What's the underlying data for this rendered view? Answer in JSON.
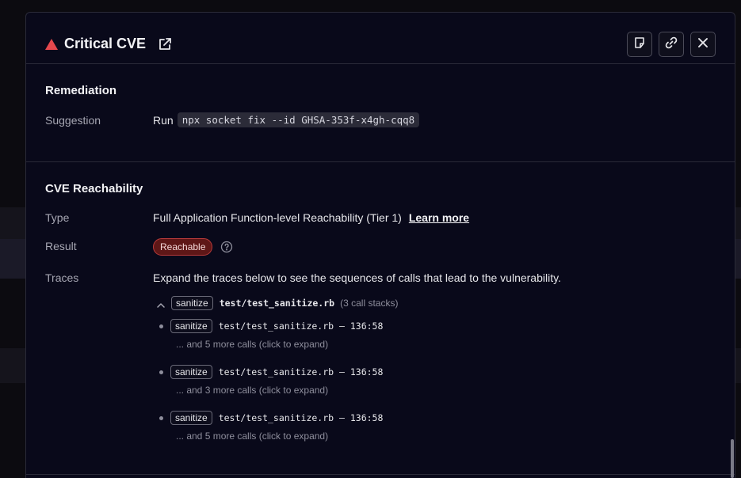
{
  "modal": {
    "title": "Critical CVE",
    "icons": {
      "severity": "warning-triangle-icon",
      "external": "external-link-icon",
      "note": "sticky-note-icon",
      "link": "link-icon",
      "close": "close-icon"
    }
  },
  "remediation": {
    "title": "Remediation",
    "suggestion_label": "Suggestion",
    "run_text": "Run",
    "command": "npx socket fix --id GHSA-353f-x4gh-cqq8"
  },
  "reachability": {
    "title": "CVE Reachability",
    "type_label": "Type",
    "type_value": "Full Application Function-level Reachability (Tier 1)",
    "learn_more": "Learn more",
    "result_label": "Result",
    "result_badge": "Reachable",
    "traces_label": "Traces",
    "traces_intro": "Expand the traces below to see the sequences of calls that lead to the vulnerability.",
    "group": {
      "fn": "sanitize",
      "file": "test/test_sanitize.rb",
      "count": "(3 call stacks)"
    },
    "traces": [
      {
        "fn": "sanitize",
        "loc": "test/test_sanitize.rb – 136:58",
        "more": "... and 5 more calls (click to expand)"
      },
      {
        "fn": "sanitize",
        "loc": "test/test_sanitize.rb – 136:58",
        "more": "... and 3 more calls (click to expand)"
      },
      {
        "fn": "sanitize",
        "loc": "test/test_sanitize.rb – 136:58",
        "more": "... and 5 more calls (click to expand)"
      }
    ]
  },
  "colors": {
    "modal_bg": "#09091a",
    "critical": "#e5484d",
    "badge_bg": "#5e1717",
    "border": "#2a2a38"
  }
}
